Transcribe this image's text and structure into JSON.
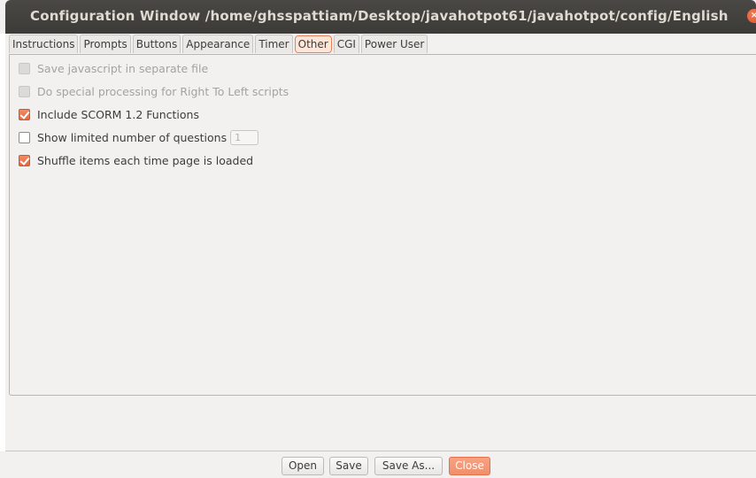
{
  "window": {
    "title": "Configuration Window  /home/ghsspattiam/Desktop/javahotpot61/javahotpot/config/English",
    "close_glyph": "×"
  },
  "tabs": [
    {
      "label": "Instructions",
      "active": false
    },
    {
      "label": "Prompts",
      "active": false
    },
    {
      "label": "Buttons",
      "active": false
    },
    {
      "label": "Appearance",
      "active": false
    },
    {
      "label": "Timer",
      "active": false
    },
    {
      "label": "Other",
      "active": true
    },
    {
      "label": "CGI",
      "active": false
    },
    {
      "label": "Power User",
      "active": false
    }
  ],
  "options": {
    "save_js": {
      "label": "Save javascript in separate file",
      "checked": false,
      "enabled": false
    },
    "rtl": {
      "label": "Do special processing for Right To Left scripts",
      "checked": false,
      "enabled": false
    },
    "scorm": {
      "label": "Include SCORM 1.2 Functions",
      "checked": true,
      "enabled": true
    },
    "limited": {
      "label": "Show limited number of questions",
      "checked": false,
      "enabled": true,
      "count_value": "1"
    },
    "shuffle": {
      "label": "Shuffle items each time page is loaded",
      "checked": true,
      "enabled": true
    }
  },
  "buttons": {
    "open": "Open",
    "save": "Save",
    "save_as": "Save As...",
    "close": "Close"
  },
  "colors": {
    "accent": "#e5683e",
    "titlebar": "#3c3b37",
    "background": "#f2f1f0"
  }
}
